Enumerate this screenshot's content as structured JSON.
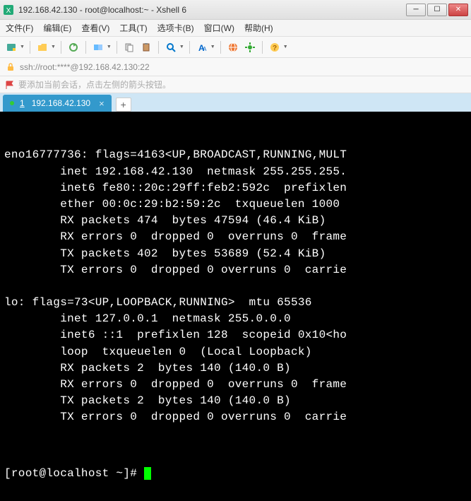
{
  "window": {
    "title": "192.168.42.130 - root@localhost:~ - Xshell 6"
  },
  "menu": {
    "file": "文件(F)",
    "edit": "编辑(E)",
    "view": "查看(V)",
    "tools": "工具(T)",
    "tabs": "选项卡(B)",
    "window": "窗口(W)",
    "help": "帮助(H)"
  },
  "address": {
    "url": "ssh://root:****@192.168.42.130:22"
  },
  "tip": {
    "text": "要添加当前会话，点击左侧的箭头按钮。"
  },
  "tab": {
    "index": "1",
    "label": "192.168.42.130",
    "add": "+"
  },
  "terminal": {
    "lines": [
      "eno16777736: flags=4163<UP,BROADCAST,RUNNING,MULT",
      "        inet 192.168.42.130  netmask 255.255.255.",
      "        inet6 fe80::20c:29ff:feb2:592c  prefixlen",
      "        ether 00:0c:29:b2:59:2c  txqueuelen 1000 ",
      "        RX packets 474  bytes 47594 (46.4 KiB)",
      "        RX errors 0  dropped 0  overruns 0  frame",
      "        TX packets 402  bytes 53689 (52.4 KiB)",
      "        TX errors 0  dropped 0 overruns 0  carrie",
      "",
      "lo: flags=73<UP,LOOPBACK,RUNNING>  mtu 65536",
      "        inet 127.0.0.1  netmask 255.0.0.0",
      "        inet6 ::1  prefixlen 128  scopeid 0x10<ho",
      "        loop  txqueuelen 0  (Local Loopback)",
      "        RX packets 2  bytes 140 (140.0 B)",
      "        RX errors 0  dropped 0  overruns 0  frame",
      "        TX packets 2  bytes 140 (140.0 B)",
      "        TX errors 0  dropped 0 overruns 0  carrie"
    ],
    "prompt": "[root@localhost ~]# "
  }
}
